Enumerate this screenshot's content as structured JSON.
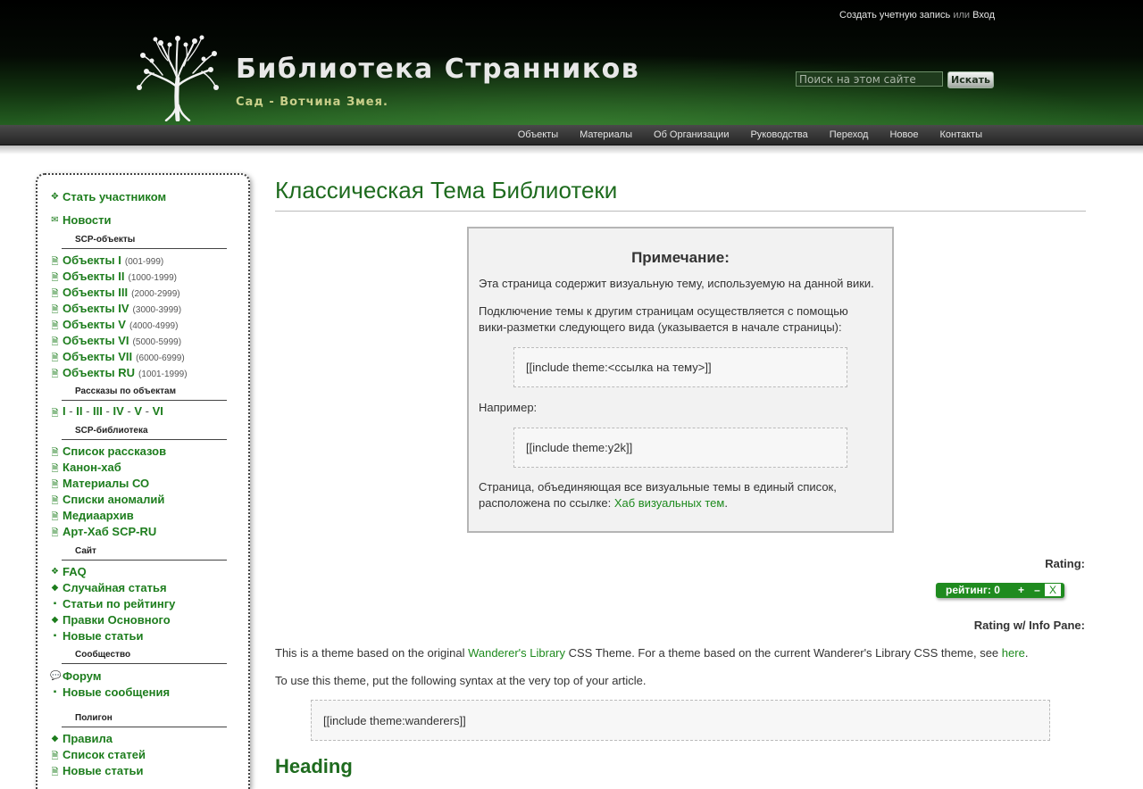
{
  "header": {
    "title": "Библиотека Странников",
    "subtitle": "Сад - Вотчина Змея.",
    "account": {
      "create": "Создать учетную запись",
      "or": "или",
      "login": "Вход"
    },
    "search": {
      "placeholder": "Поиск на этом сайте",
      "button": "Искать"
    }
  },
  "topnav": [
    "Объекты",
    "Материалы",
    "Об Организации",
    "Руководства",
    "Переход",
    "Новое",
    "Контакты"
  ],
  "sidebar": {
    "join": "Стать участником",
    "news": "Новости",
    "scp_objects_head": "SCP-объекты",
    "objects": [
      {
        "label": "Объекты I",
        "range": "(001-999)"
      },
      {
        "label": "Объекты II",
        "range": "(1000-1999)"
      },
      {
        "label": "Объекты III",
        "range": "(2000-2999)"
      },
      {
        "label": "Объекты IV",
        "range": "(3000-3999)"
      },
      {
        "label": "Объекты V",
        "range": "(4000-4999)"
      },
      {
        "label": "Объекты VI",
        "range": "(5000-5999)"
      },
      {
        "label": "Объекты VII",
        "range": "(6000-6999)"
      },
      {
        "label": "Объекты RU",
        "range": "(1001-1999)"
      }
    ],
    "stories_head": "Рассказы по объектам",
    "stories_roman": [
      "I",
      "II",
      "III",
      "IV",
      "V",
      "VI"
    ],
    "library_head": "SCP-библиотека",
    "library": [
      "Список рассказов",
      "Канон-хаб",
      "Материалы СО",
      "Списки аномалий",
      "Медиаархив",
      "Арт-Хаб SCP-RU"
    ],
    "site_head": "Сайт",
    "site": [
      "FAQ",
      "Случайная статья",
      "Статьи по рейтингу",
      "Правки Основного",
      "Новые статьи"
    ],
    "community_head": "Сообщество",
    "community": [
      "Форум",
      "Новые сообщения"
    ],
    "polygon_head": "Полигон",
    "polygon": [
      "Правила",
      "Список статей",
      "Новые статьи"
    ]
  },
  "main": {
    "title": "Классическая Тема Библиотеки",
    "note": {
      "title": "Примечание:",
      "p1": "Эта страница содержит визуальную тему, используемую на данной вики.",
      "p2": "Подключение темы к другим страницам осуществляется с помощью вики-разметки следующего вида (указывается в начале страницы):",
      "code1": "[[include theme:<ссылка на тему>]]",
      "example_label": "Например:",
      "code2": "[[include theme:y2k]]",
      "p3_before": "Страница, объединяющая все визуальные темы в единый список, расположена по ссылке: ",
      "p3_link": "Хаб визуальных тем",
      "p3_after": "."
    },
    "rating_label": "Rating:",
    "rating": {
      "text": "рейтинг: 0",
      "plus": "+",
      "minus": "–",
      "cancel": "X"
    },
    "rating_info_label": "Rating w/ Info Pane:",
    "p1_before": "This is a theme based on the original ",
    "p1_link1": "Wanderer's Library",
    "p1_mid": " CSS Theme. For a theme based on the current Wanderer's Library CSS theme, see ",
    "p1_link2": "here",
    "p1_after": ".",
    "p2": "To use this theme, put the following syntax at the very top of your article.",
    "code": "[[include theme:wanderers]]",
    "heading": "Heading"
  }
}
